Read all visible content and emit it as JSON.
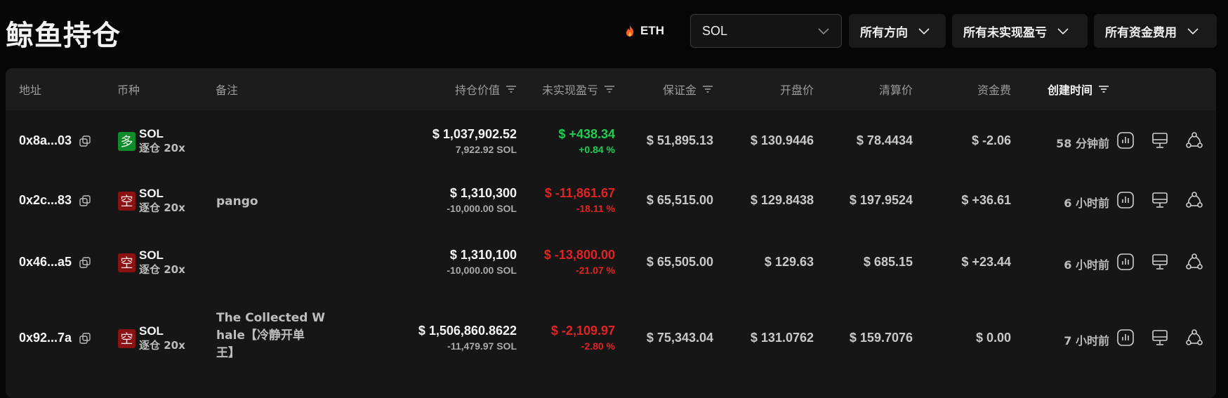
{
  "page": {
    "title": "鲸鱼持仓"
  },
  "toolbar": {
    "hot_symbol": "ETH",
    "symbol_select": "SOL",
    "direction_filter": "所有方向",
    "pnl_filter": "所有未实现盈亏",
    "funding_filter": "所有资金费用"
  },
  "table": {
    "headers": {
      "address": "地址",
      "coin": "币种",
      "note": "备注",
      "position_value": "持仓价值",
      "unrealized_pnl": "未实现盈亏",
      "margin": "保证金",
      "open_price": "开盘价",
      "liq_price": "清算价",
      "funding": "资金费",
      "created": "创建时间"
    },
    "rows": [
      {
        "address": "0x8a...03",
        "side_badge": "多",
        "coin": "SOL",
        "margin_mode": "逐仓 20x",
        "note_lines": [
          "",
          ""
        ],
        "value": "$ 1,037,902.52",
        "size": "7,922.92 SOL",
        "pnl": "$ +438.34",
        "pnl_pct": "+0.84 %",
        "margin": "$ 51,895.13",
        "open_price": "$ 130.9446",
        "liq_price": "$ 78.4434",
        "funding": "$ -2.06",
        "created": "58 分钟前"
      },
      {
        "address": "0x2c...83",
        "side_badge": "空",
        "coin": "SOL",
        "margin_mode": "逐仓 20x",
        "note_lines": [
          "pango",
          ""
        ],
        "value": "$ 1,310,300",
        "size": "-10,000.00 SOL",
        "pnl": "$ -11,861.67",
        "pnl_pct": "-18.11 %",
        "margin": "$ 65,515.00",
        "open_price": "$ 129.8438",
        "liq_price": "$ 197.9524",
        "funding": "$ +36.61",
        "created": "6 小时前"
      },
      {
        "address": "0x46...a5",
        "side_badge": "空",
        "coin": "SOL",
        "margin_mode": "逐仓 20x",
        "note_lines": [
          "",
          ""
        ],
        "value": "$ 1,310,100",
        "size": "-10,000.00 SOL",
        "pnl": "$ -13,800.00",
        "pnl_pct": "-21.07 %",
        "margin": "$ 65,505.00",
        "open_price": "$ 129.63",
        "liq_price": "$ 685.15",
        "funding": "$ +23.44",
        "created": "6 小时前"
      },
      {
        "address": "0x92...7a",
        "side_badge": "空",
        "coin": "SOL",
        "margin_mode": "逐仓 20x",
        "note_lines": [
          "The Collected W",
          "hale【冷静开单",
          "王】"
        ],
        "value": "$ 1,506,860.8622",
        "size": "-11,479.97 SOL",
        "pnl": "$ -2,109.97",
        "pnl_pct": "-2.80 %",
        "margin": "$ 75,343.04",
        "open_price": "$ 131.0762",
        "liq_price": "$ 159.7076",
        "funding": "$ 0.00",
        "created": "7 小时前"
      }
    ]
  },
  "colors": {
    "background": "#060606",
    "panel": "#161616",
    "positive": "#1fcc52",
    "negative": "#e02424",
    "long_badge": "#118a2c",
    "short_badge": "#8b1212"
  },
  "icons": [
    "flame-icon",
    "chevron-down-icon",
    "sort-icon",
    "copy-icon",
    "chart-icon",
    "monitor-icon",
    "share-icon"
  ]
}
